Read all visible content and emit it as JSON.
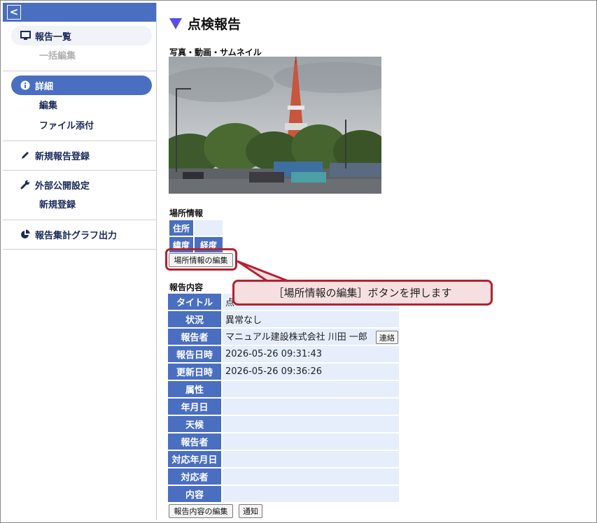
{
  "sidebar": {
    "collapse_glyph": "<",
    "items": [
      {
        "label": "報告一覧",
        "icon": "monitor-icon"
      },
      {
        "label": "一括編集"
      },
      {
        "label": "詳細",
        "icon": "info-icon"
      },
      {
        "label": "編集"
      },
      {
        "label": "ファイル添付"
      },
      {
        "label": "新規報告登録",
        "icon": "pencil-icon"
      },
      {
        "label": "外部公開設定",
        "icon": "wrench-icon"
      },
      {
        "label": "新規登録"
      },
      {
        "label": "報告集計グラフ出力",
        "icon": "pie-chart-icon"
      }
    ]
  },
  "main": {
    "title": "点検報告",
    "media_label": "写真・動画・サムネイル",
    "location": {
      "label": "場所情報",
      "address_header": "住所",
      "lat_header": "緯度",
      "lng_header": "経度",
      "edit_button": "場所情報の編集"
    },
    "callout": "［場所情報の編集］ボタンを押します",
    "report": {
      "label": "報告内容",
      "rows": [
        {
          "key": "タイトル",
          "value": "点"
        },
        {
          "key": "状況",
          "value": "異常なし"
        },
        {
          "key": "報告者",
          "value": "マニュアル建設株式会社 川田 一郎"
        },
        {
          "key": "報告日時",
          "value": "2026-05-26 09:31:43"
        },
        {
          "key": "更新日時",
          "value": "2026-05-26 09:36:26"
        },
        {
          "key": "属性",
          "value": ""
        },
        {
          "key": "年月日",
          "value": ""
        },
        {
          "key": "天候",
          "value": ""
        },
        {
          "key": "報告者",
          "value": ""
        },
        {
          "key": "対応年月日",
          "value": ""
        },
        {
          "key": "対応者",
          "value": ""
        },
        {
          "key": "内容",
          "value": ""
        }
      ],
      "contact_button": "連絡",
      "edit_button": "報告内容の編集",
      "notify_button": "通知"
    },
    "colors": {
      "accent": "#4a6fc1",
      "callout_border": "#b2222f",
      "callout_fill": "#f6dfe1"
    }
  }
}
